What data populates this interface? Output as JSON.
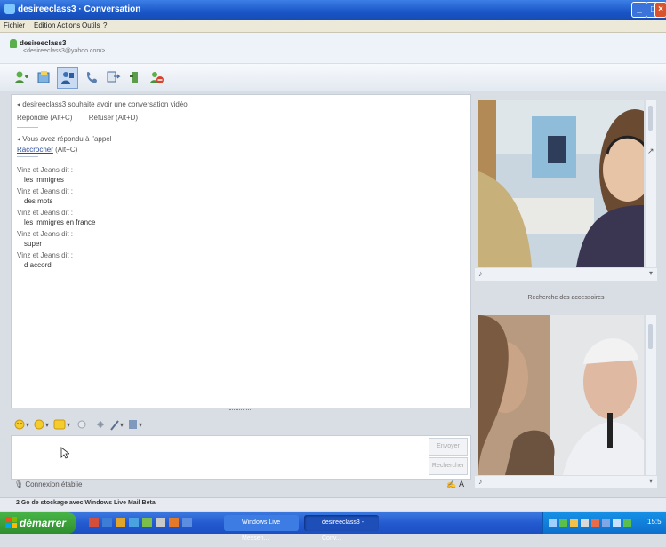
{
  "window": {
    "title": "desireeclass3 · Conversation"
  },
  "menu": [
    "Fichier",
    "Edition",
    "Actions",
    "Outils",
    "?"
  ],
  "contact": {
    "name": "desireeclass3",
    "email": "<desireeclass3@yahoo.com>"
  },
  "conversation": {
    "invite_text": "desireeclass3 souhaite avoir une conversation vidéo",
    "accept_label": "Répondre (Alt+C)",
    "decline_label": "Refuser (Alt+D)",
    "answered_text": "Vous avez répondu à l'appel",
    "hangup_link": "Raccrocher",
    "hangup_shortcut": "(Alt+C)",
    "messages": [
      {
        "sender": "Vinz et Jeans dit :",
        "text": "les immigres"
      },
      {
        "sender": "Vinz et Jeans dit :",
        "text": "des mots"
      },
      {
        "sender": "Vinz et Jeans dit :",
        "text": "les immigres en france"
      },
      {
        "sender": "Vinz et Jeans dit :",
        "text": "super"
      },
      {
        "sender": "Vinz et Jeans dit :",
        "text": "d accord"
      }
    ]
  },
  "input": {
    "send_label": "Envoyer",
    "search_label": "Rechercher"
  },
  "input_status": "Connexion établie",
  "video": {
    "separator_label": "Recherche des accessoires"
  },
  "status_bar": "2 Go de stockage avec Windows Live Mail Beta",
  "taskbar": {
    "start_label": "démarrer",
    "tasks": [
      "Windows Live Messen...",
      "desireeclass3 - Conv..."
    ],
    "clock": "15:5"
  },
  "colors": {
    "titlebar": "#1a56c8",
    "taskbar": "#245bd0",
    "start": "#3a9c39",
    "link": "#2a4c9c"
  }
}
